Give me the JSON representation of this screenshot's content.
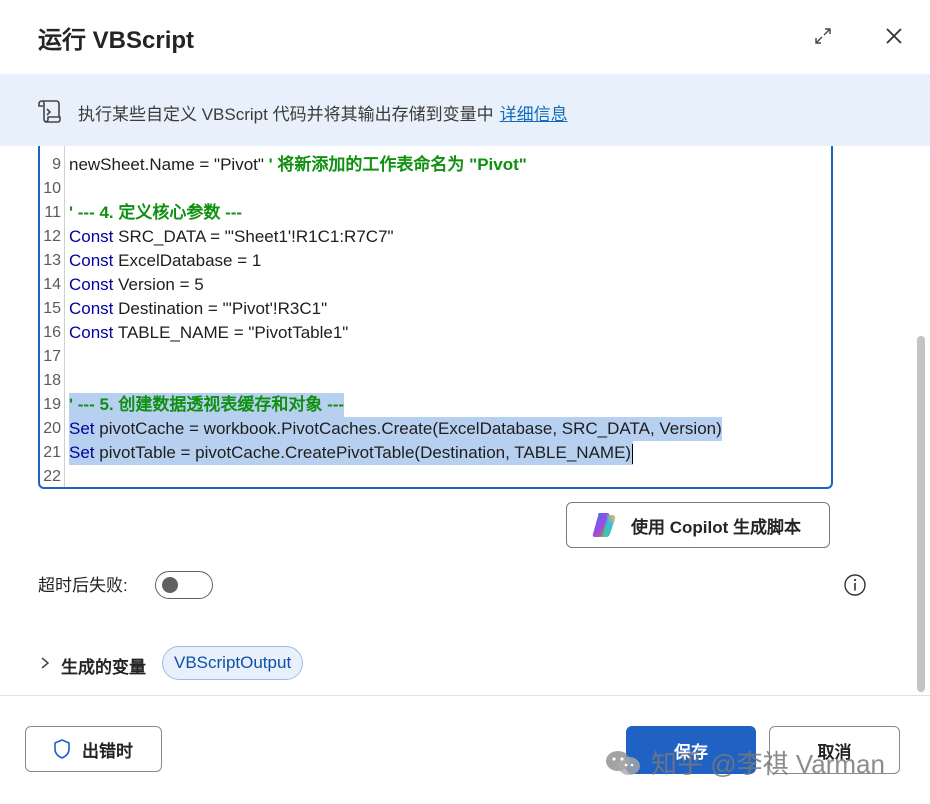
{
  "dialog": {
    "title": "运行 VBScript"
  },
  "banner": {
    "text": "执行某些自定义 VBScript 代码并将其输出存储到变量中",
    "link": "详细信息"
  },
  "editor": {
    "lines": [
      {
        "n": "9",
        "tokens": [
          {
            "t": "newSheet.Name = \"Pivot\" ",
            "c": "code"
          },
          {
            "t": "' 将新添加的工作表命名为 \"Pivot\"",
            "c": "cm"
          }
        ]
      },
      {
        "n": "10",
        "tokens": []
      },
      {
        "n": "11",
        "tokens": [
          {
            "t": "' --- 4. 定义核心参数 ---",
            "c": "cm"
          }
        ]
      },
      {
        "n": "12",
        "tokens": [
          {
            "t": "Const",
            "c": "kw"
          },
          {
            "t": " SRC_DATA = \"'Sheet1'!R1C1:R7C7\"",
            "c": "code"
          }
        ]
      },
      {
        "n": "13",
        "tokens": [
          {
            "t": "Const",
            "c": "kw"
          },
          {
            "t": " ExcelDatabase = 1",
            "c": "code"
          }
        ]
      },
      {
        "n": "14",
        "tokens": [
          {
            "t": "Const",
            "c": "kw"
          },
          {
            "t": " Version = 5",
            "c": "code"
          }
        ]
      },
      {
        "n": "15",
        "tokens": [
          {
            "t": "Const",
            "c": "kw"
          },
          {
            "t": " Destination = \"'Pivot'!R3C1\"",
            "c": "code"
          }
        ]
      },
      {
        "n": "16",
        "tokens": [
          {
            "t": "Const",
            "c": "kw"
          },
          {
            "t": " TABLE_NAME = \"PivotTable1\"",
            "c": "code"
          }
        ]
      },
      {
        "n": "17",
        "tokens": []
      },
      {
        "n": "18",
        "tokens": []
      },
      {
        "n": "19",
        "tokens": [
          {
            "t": "' --- 5. 创建数据透视表缓存和对象 ---",
            "c": "cm"
          }
        ]
      },
      {
        "n": "20",
        "tokens": [
          {
            "t": "Set",
            "c": "kw"
          },
          {
            "t": " pivotCache = workbook.PivotCaches.Create(ExcelDatabase, SRC_DATA, Version)",
            "c": "code"
          }
        ]
      },
      {
        "n": "21",
        "tokens": [
          {
            "t": "Set",
            "c": "kw"
          },
          {
            "t": " pivotTable = pivotCache.CreatePivotTable(Destination, TABLE_NAME)",
            "c": "code"
          }
        ]
      },
      {
        "n": "22",
        "tokens": []
      }
    ]
  },
  "copilot": {
    "label": "使用 Copilot 生成脚本"
  },
  "timeout": {
    "label": "超时后失败:"
  },
  "variables": {
    "label": "生成的变量",
    "chip": "VBScriptOutput"
  },
  "footer": {
    "error_label": "出错时",
    "save_label": "保存",
    "cancel_label": "取消"
  },
  "watermark": {
    "text": "知乎 @李祺 Varman"
  },
  "colors": {
    "accent": "#1f62c4",
    "comment": "#109010",
    "keyword": "#0000a0",
    "banner_bg": "#e8f0fb",
    "selection": "#b8d0f0"
  }
}
